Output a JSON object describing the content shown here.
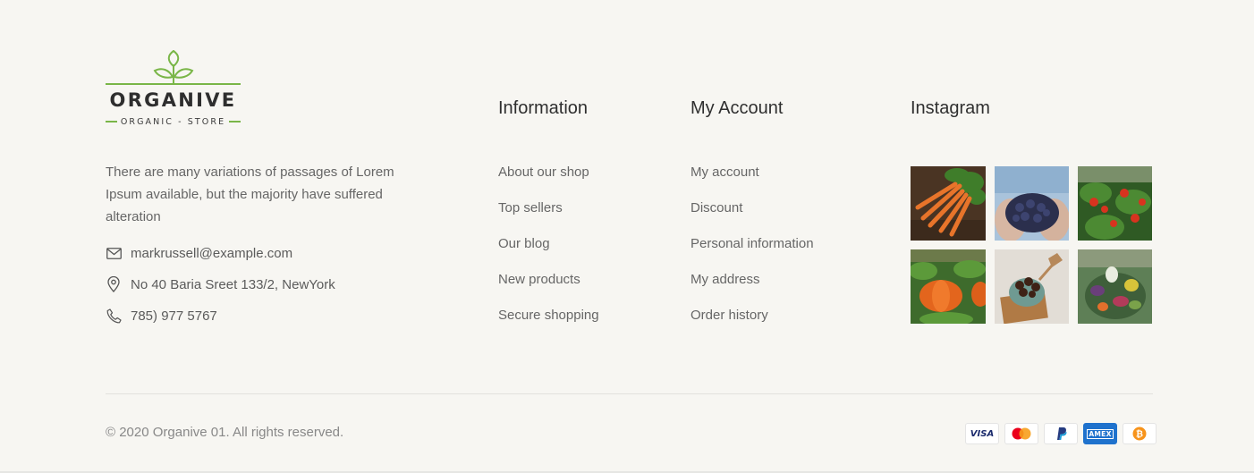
{
  "brand": {
    "name": "ORGANIVE",
    "tagline": "ORGANIC - STORE",
    "accent_color": "#7ab648"
  },
  "about": {
    "text": "There are many variations of passages of Lorem Ipsum available, but the majority have suffered alteration",
    "email": "markrussell@example.com",
    "address": "No 40 Baria Sreet 133/2, NewYork",
    "phone": "785) 977 5767",
    "email_icon": "mail-icon",
    "address_icon": "map-pin-icon",
    "phone_icon": "phone-icon"
  },
  "information": {
    "title": "Information",
    "links": [
      "About our shop",
      "Top sellers",
      "Our blog",
      "New products",
      "Secure shopping"
    ]
  },
  "account": {
    "title": "My Account",
    "links": [
      "My account",
      "Discount",
      "Personal information",
      "My address",
      "Order history"
    ]
  },
  "instagram": {
    "title": "Instagram",
    "photos": [
      "carrots-photo",
      "blueberries-photo",
      "tomatoes-photo",
      "pumpkins-photo",
      "chocolate-photo",
      "vegetables-basket-photo"
    ]
  },
  "bottom": {
    "copyright": "© 2020 Organive 01. All rights reserved.",
    "payments": [
      "visa-icon",
      "mastercard-icon",
      "paypal-icon",
      "amex-icon",
      "bitcoin-icon"
    ],
    "visa_label": "VISA",
    "amex_label": "AMEX"
  }
}
